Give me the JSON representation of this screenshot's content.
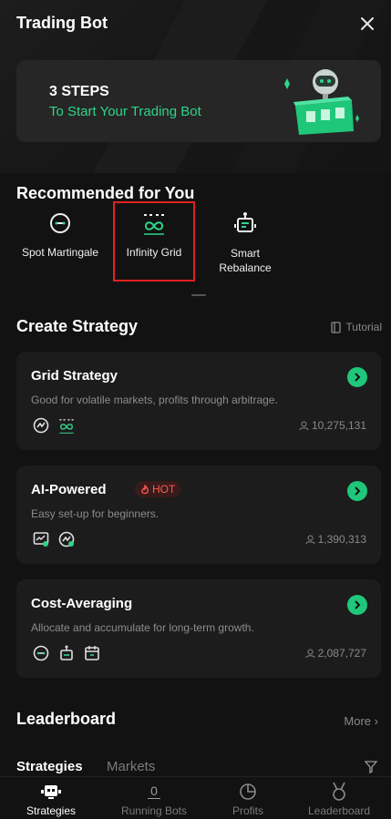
{
  "header": {
    "title": "Trading Bot"
  },
  "banner": {
    "line1": "3 STEPS",
    "line2": "To Start Your Trading Bot"
  },
  "recommended": {
    "title": "Recommended for You",
    "items": [
      {
        "label": "Spot Martingale",
        "icon": "martingale-icon"
      },
      {
        "label": "Infinity Grid",
        "icon": "infinity-icon"
      },
      {
        "label": "Smart Rebalance",
        "icon": "robot-icon"
      }
    ]
  },
  "create": {
    "title": "Create Strategy",
    "tutorial": "Tutorial",
    "cards": [
      {
        "title": "Grid Strategy",
        "desc": "Good for volatile markets, profits through arbitrage.",
        "count": "10,275,131"
      },
      {
        "title": "AI-Powered",
        "badge": "HOT",
        "desc": "Easy set-up for beginners.",
        "count": "1,390,313"
      },
      {
        "title": "Cost-Averaging",
        "desc": "Allocate and accumulate for long-term growth.",
        "count": "2,087,727"
      }
    ]
  },
  "leaderboard": {
    "title": "Leaderboard",
    "more": "More",
    "tabs": [
      "Strategies",
      "Markets"
    ]
  },
  "nav": {
    "running_badge": "0",
    "items": [
      {
        "label": "Strategies",
        "icon": "strategies-icon"
      },
      {
        "label": "Running Bots",
        "icon": "running-bots-icon"
      },
      {
        "label": "Profits",
        "icon": "pie-chart-icon"
      },
      {
        "label": "Leaderboard",
        "icon": "medal-icon"
      }
    ]
  },
  "colors": {
    "accent": "#1fc77a",
    "highlight_box": "#e32020",
    "hot": "#ff5b4f"
  }
}
